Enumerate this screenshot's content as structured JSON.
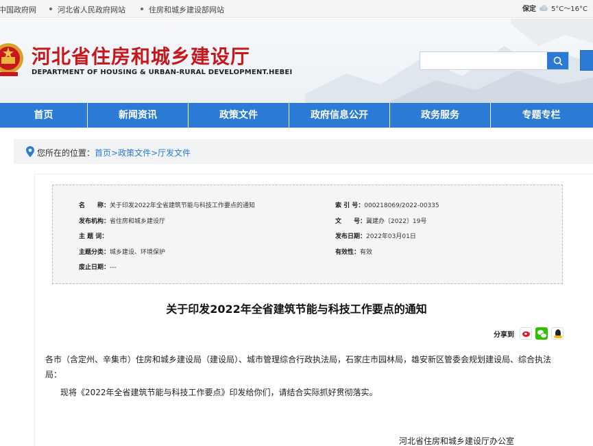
{
  "topbar": {
    "links": [
      "中国政府网",
      "河北省人民政府网站",
      "住房和城乡建设部网站"
    ],
    "weather_city": "保定",
    "weather_temp": "5°C～16°C"
  },
  "header": {
    "title": "河北省住房和城乡建设厅",
    "subtitle": "DEPARTMENT OF HOUSING & URBAN-RURAL DEVELOPMENT.HEBEI",
    "search_placeholder": "",
    "colors": {
      "title_red": "#c8161d",
      "accent_blue": "#2b7bd6"
    }
  },
  "nav": {
    "items": [
      "首页",
      "新闻资讯",
      "政策文件",
      "政府信息公开",
      "政务服务",
      "专题专栏"
    ]
  },
  "breadcrumb": {
    "prefix": "您所在的位置：",
    "items": [
      "首页",
      "政策文件",
      "厅发文件"
    ],
    "separator": ">"
  },
  "meta": {
    "name_label": "名　　称：",
    "name_value": "关于印发2022年全省建筑节能与科技工作要点的通知",
    "publisher_label": "发布机构：",
    "publisher_value": "省住房和城乡建设厅",
    "keywords_label": "主 题 词：",
    "keywords_value": "",
    "category_label": "主题分类：",
    "category_value": "城乡建设、环境保护",
    "repeal_label": "废止日期：",
    "repeal_value": "---",
    "index_label": "索 引 号：",
    "index_value": "000218069/2022-00335",
    "docno_label": "文　　号：",
    "docno_value": "冀建办〔2022〕19号",
    "date_label": "发布日期：",
    "date_value": "2022年03月01日",
    "validity_label": "有效性：",
    "validity_value": "有效"
  },
  "article": {
    "title": "关于印发2022年全省建筑节能与科技工作要点的通知",
    "share_label": "分享到",
    "para1": "各市（含定州、辛集市）住房和城乡建设局（建设局）、城市管理综合行政执法局，石家庄市园林局，雄安新区管委会规划建设局、综合执法局：",
    "para2": "现将《2022年全省建筑节能与科技工作要点》印发给你们，请结合实际抓好贯彻落实。",
    "signoff": "河北省住房和城乡建设厅办公室"
  }
}
